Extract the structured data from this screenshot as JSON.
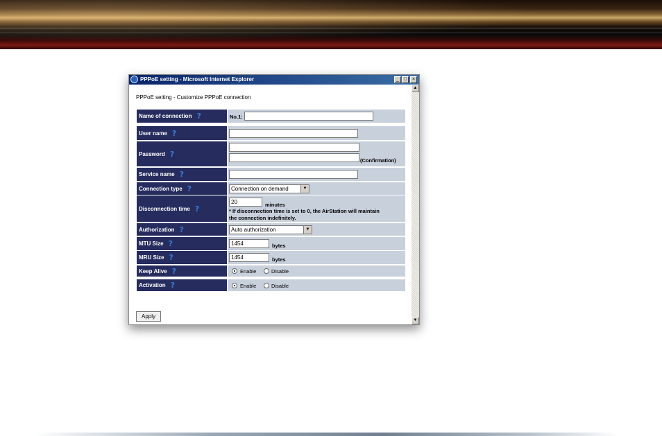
{
  "window": {
    "title": "PPPoE setting - Microsoft Internet Explorer"
  },
  "page": {
    "heading": "PPPoE setting - Customize PPPoE connection"
  },
  "form": {
    "name_of_connection": {
      "label": "Name of connection",
      "prefix": "No.1:",
      "value": ""
    },
    "user_name": {
      "label": "User name",
      "value": ""
    },
    "password": {
      "label": "Password",
      "value": "",
      "confirmation_value": "",
      "confirmation_label": "(Confirmation)"
    },
    "service_name": {
      "label": "Service name",
      "value": ""
    },
    "connection_type": {
      "label": "Connection type",
      "selected": "Connection on demand"
    },
    "disconnection_time": {
      "label": "Disconnection time",
      "value": "20",
      "unit": "minutes",
      "note_line1": "* If disconnection time is set to 0, the AirStation will maintain",
      "note_line2": "the connection indefinitely."
    },
    "authorization": {
      "label": "Authorization",
      "selected": "Auto authorization"
    },
    "mtu_size": {
      "label": "MTU Size",
      "value": "1454",
      "unit": "bytes"
    },
    "mru_size": {
      "label": "MRU Size",
      "value": "1454",
      "unit": "bytes"
    },
    "keep_alive": {
      "label": "Keep Alive",
      "enable": "Enable",
      "disable": "Disable",
      "selected": "Enable"
    },
    "activation": {
      "label": "Activation",
      "enable": "Enable",
      "disable": "Disable",
      "selected": "Enable"
    },
    "apply_label": "Apply",
    "help_icon": "?"
  },
  "colors": {
    "label_bg": "#262c5e",
    "value_bg": "#c8d0dc",
    "help_icon": "#3a7ad8",
    "titlebar": "#0a246a"
  }
}
